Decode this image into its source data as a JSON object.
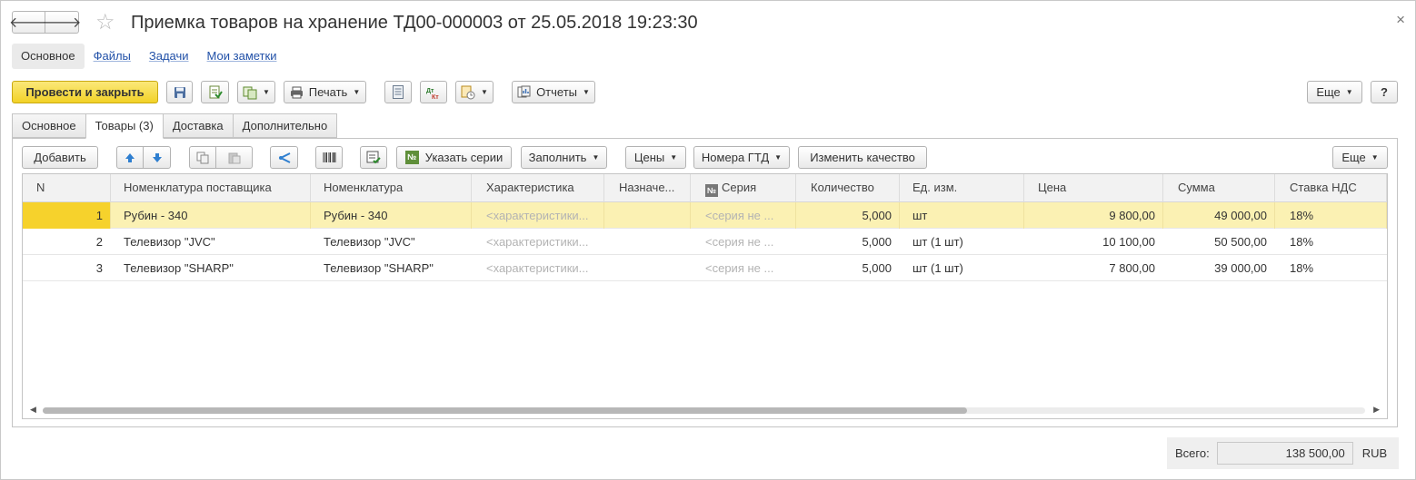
{
  "window": {
    "title": "Приемка товаров на хранение ТД00-000003 от 25.05.2018 19:23:30",
    "back_glyph": "🡐",
    "forward_glyph": "🡒",
    "star_glyph": "☆",
    "close_glyph": "×"
  },
  "top_panel": {
    "items": [
      "Основное",
      "Файлы",
      "Задачи",
      "Мои заметки"
    ]
  },
  "command_bar": {
    "post_close_label": "Провести и закрыть",
    "print_label": "Печать",
    "dtkt_label": "Дт Кт",
    "reports_label": "Отчеты",
    "more_label": "Еще",
    "help_label": "?"
  },
  "tabs": [
    "Основное",
    "Товары (3)",
    "Доставка",
    "Дополнительно"
  ],
  "table_toolbar": {
    "add_label": "Добавить",
    "series_label": "Указать серии",
    "fill_label": "Заполнить",
    "prices_label": "Цены",
    "gtd_label": "Номера ГТД",
    "quality_label": "Изменить качество",
    "more_label": "Еще"
  },
  "grid": {
    "columns": [
      "N",
      "Номенклатура поставщика",
      "Номенклатура",
      "Характеристика",
      "Назначе...",
      "Серия",
      "Количество",
      "Ед. изм.",
      "Цена",
      "Сумма",
      "Ставка НДС"
    ],
    "rows": [
      [
        "1",
        "Рубин - 340",
        "Рубин - 340",
        "<характеристики...",
        "",
        "<серия не ...",
        "5,000",
        "шт",
        "9 800,00",
        "49 000,00",
        "18%"
      ],
      [
        "2",
        "Телевизор \"JVC\"",
        "Телевизор \"JVC\"",
        "<характеристики...",
        "",
        "<серия не ...",
        "5,000",
        "шт (1 шт)",
        "10 100,00",
        "50 500,00",
        "18%"
      ],
      [
        "3",
        "Телевизор \"SHARP\"",
        "Телевизор \"SHARP\"",
        "<характеристики...",
        "",
        "<серия не ...",
        "5,000",
        "шт (1 шт)",
        "7 800,00",
        "39 000,00",
        "18%"
      ]
    ]
  },
  "footer": {
    "total_label": "Всего:",
    "total_value": "138 500,00",
    "currency": "RUB"
  },
  "colors": {
    "primary_button": "#f2d227",
    "selected_row": "#fbf1b3",
    "link": "#2251a8"
  }
}
